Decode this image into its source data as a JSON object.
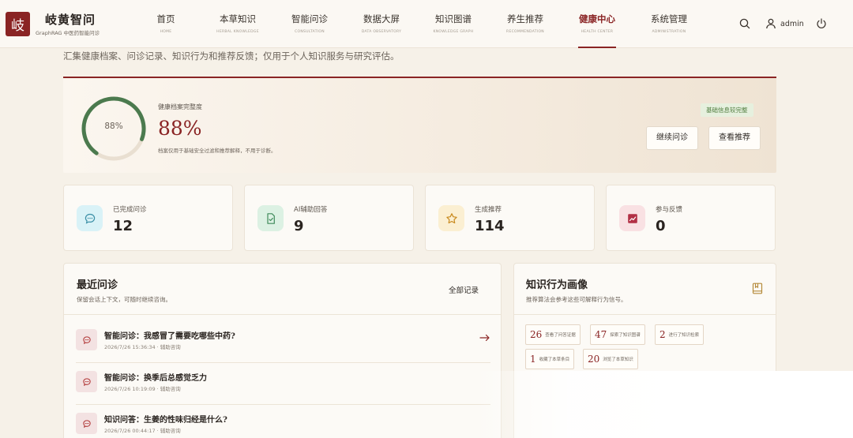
{
  "brand": {
    "logo_char": "岐",
    "name": "岐黄智问",
    "subtitle": "GraphRAG 中医药智能问诊"
  },
  "nav": [
    {
      "label": "首页",
      "en": "HOME"
    },
    {
      "label": "本草知识",
      "en": "HERBAL KNOWLEDGE"
    },
    {
      "label": "智能问诊",
      "en": "CONSULTATION"
    },
    {
      "label": "数据大屏",
      "en": "DATA OBSERVATORY"
    },
    {
      "label": "知识图谱",
      "en": "KNOWLEDGE GRAPH"
    },
    {
      "label": "养生推荐",
      "en": "RECOMMENDATION"
    },
    {
      "label": "健康中心",
      "en": "HEALTH CENTER"
    },
    {
      "label": "系统管理",
      "en": "ADMINISTRATION"
    }
  ],
  "user": {
    "name": "admin"
  },
  "intro": "汇集健康档案、问诊记录、知识行为和推荐反馈；仅用于个人知识服务与研究评估。",
  "profile": {
    "ring_text": "88%",
    "label": "健康档案完整度",
    "value": "88%",
    "progress": 0.88,
    "note": "档案仅用于基础安全过滤和推荐解释，不用于诊断。",
    "badge": "基础信息较完整",
    "btn_continue": "继续问诊",
    "btn_recommend": "查看推荐"
  },
  "stats": [
    {
      "label": "已完成问诊",
      "value": "12",
      "icon": "chat-icon",
      "bg": "#d9f2f7",
      "fg": "#3b8fa6"
    },
    {
      "label": "AI辅助回答",
      "value": "9",
      "icon": "doc-check-icon",
      "bg": "#dcf1e3",
      "fg": "#3f8a5a"
    },
    {
      "label": "生成推荐",
      "value": "114",
      "icon": "star-icon",
      "bg": "#fbefd2",
      "fg": "#c98a1e"
    },
    {
      "label": "参与反馈",
      "value": "0",
      "icon": "chart-icon",
      "bg": "#f9e1e3",
      "fg": "#b23045"
    }
  ],
  "recent": {
    "title": "最近问诊",
    "subtitle": "保留会话上下文，可随时继续咨询。",
    "all_label": "全部记录",
    "items": [
      {
        "title": "智能问诊：我感冒了需要吃哪些中药?",
        "meta": "2026/7/26 15:36:34 · 辅助咨询"
      },
      {
        "title": "智能问诊：换季后总感觉乏力",
        "meta": "2026/7/26 10:19:09 · 辅助咨询"
      },
      {
        "title": "知识问答：生姜的性味归经是什么?",
        "meta": "2026/7/26 00:44:17 · 辅助咨询"
      }
    ]
  },
  "behavior": {
    "title": "知识行为画像",
    "subtitle": "推荐算法会参考这些可解释行为信号。",
    "tags": [
      {
        "num": "26",
        "text": "查看了问答证据"
      },
      {
        "num": "47",
        "text": "探索了知识图谱"
      },
      {
        "num": "2",
        "text": "进行了知识检索"
      },
      {
        "num": "1",
        "text": "收藏了本草条目"
      },
      {
        "num": "20",
        "text": "浏览了本草知识"
      }
    ]
  },
  "colors": {
    "accent": "#8a2424",
    "ring": "#4b7a4e",
    "background": "#f6f1e8"
  }
}
